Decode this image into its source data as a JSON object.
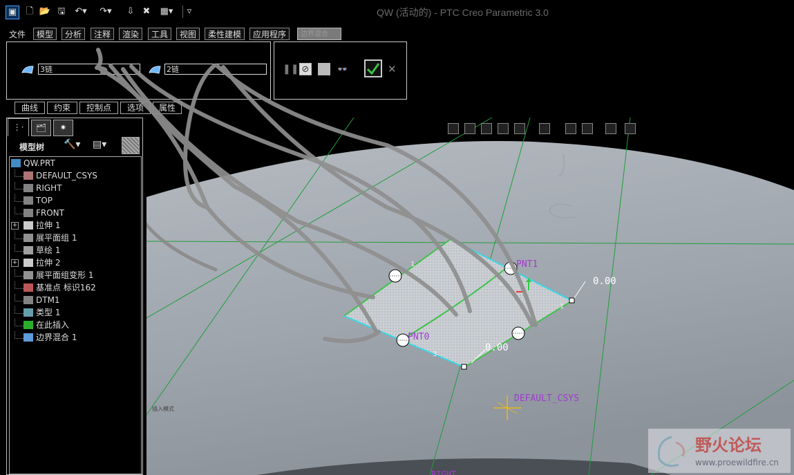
{
  "window": {
    "title": "QW (活动的) - PTC Creo Parametric 3.0"
  },
  "quick_access": {
    "icons": [
      "app-icon",
      "new-icon",
      "open-icon",
      "save-icon",
      "undo-icon",
      "redo-icon",
      "regenerate-icon",
      "close-window-icon",
      "windows-icon",
      "customize-icon"
    ]
  },
  "menu": {
    "items": [
      "文件",
      "模型",
      "分析",
      "注释",
      "渲染",
      "工具",
      "视图",
      "柔性建模",
      "应用程序"
    ],
    "active_tab": "边界混合"
  },
  "dashboard": {
    "first_direction_value": "3链",
    "second_direction_value": "2链",
    "sub_tabs": [
      "曲线",
      "约束",
      "控制点",
      "选项",
      "属性"
    ]
  },
  "model_tree": {
    "header": "模型树",
    "items": [
      {
        "label": "QW.PRT",
        "icon": "part-icon",
        "indent": 0,
        "expand": false
      },
      {
        "label": "DEFAULT_CSYS",
        "icon": "csys-icon",
        "indent": 1,
        "expand": false
      },
      {
        "label": "RIGHT",
        "icon": "datum-plane-icon",
        "indent": 1,
        "expand": false
      },
      {
        "label": "TOP",
        "icon": "datum-plane-icon",
        "indent": 1,
        "expand": false
      },
      {
        "label": "FRONT",
        "icon": "datum-plane-icon",
        "indent": 1,
        "expand": false
      },
      {
        "label": "拉伸 1",
        "icon": "extrude-icon",
        "indent": 1,
        "expand": true
      },
      {
        "label": "展平面组 1",
        "icon": "flatten-quilt-icon",
        "indent": 1,
        "expand": false
      },
      {
        "label": "草绘 1",
        "icon": "sketch-icon",
        "indent": 1,
        "expand": false
      },
      {
        "label": "拉伸 2",
        "icon": "extrude-icon",
        "indent": 1,
        "expand": true
      },
      {
        "label": "展平面组变形 1",
        "icon": "flatten-deform-icon",
        "indent": 1,
        "expand": false
      },
      {
        "label": "基准点 标识162",
        "icon": "datum-point-icon",
        "indent": 1,
        "expand": false
      },
      {
        "label": "DTM1",
        "icon": "datum-plane-icon",
        "indent": 1,
        "expand": false
      },
      {
        "label": "类型 1",
        "icon": "type-icon",
        "indent": 1,
        "expand": false
      },
      {
        "label": "在此插入",
        "icon": "insert-here-icon",
        "indent": 1,
        "expand": false
      },
      {
        "label": "边界混合 1",
        "icon": "boundary-blend-icon",
        "indent": 1,
        "expand": false
      }
    ]
  },
  "viewport": {
    "labels": {
      "pnt1": "PNT1",
      "pnt0": "PNT0",
      "dim_right": "0.00",
      "dim_bottom": "0.00",
      "csys": "DEFAULT_CSYS",
      "bottom_partial": "RIGHT",
      "side_note": "插入模式"
    },
    "edge_numbers": [
      "1",
      "2",
      "1",
      "3"
    ]
  },
  "watermark": {
    "title": "野火论坛",
    "url": "www.proewildfire.cn"
  },
  "colors": {
    "surface_gray": "#9aa2ab",
    "datum_green": "#1e9e3a",
    "edge_cyan": "#38d7e6",
    "label_purple": "#a23bd0",
    "mesh_fill": "#c9ccd0"
  }
}
